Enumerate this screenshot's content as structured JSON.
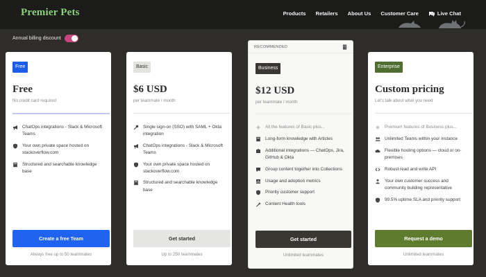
{
  "brand": {
    "name": "Premier Pets"
  },
  "nav": {
    "items": [
      "Products",
      "Retailers",
      "About Us",
      "Customer Care"
    ],
    "chat_label": "Live Chat"
  },
  "billing": {
    "label": "Annual billing discount",
    "enabled": true
  },
  "accent_colors": {
    "free": "#1d5ce8",
    "business": "#3a3733",
    "enterprise": "#4f6d31",
    "toggle": "#c8467e",
    "logo": "#8bd17c"
  },
  "plans": [
    {
      "badge": "Free",
      "price": "Free",
      "subtitle": "No credit card required",
      "features": [
        {
          "icon": "megaphone-icon",
          "text": "ChatOps integrations - Slack & Microsoft Teams"
        },
        {
          "icon": "shield-icon",
          "text": "Your own private space hosted on stackoverflow.com"
        },
        {
          "icon": "book-icon",
          "text": "Structured and searchable knowledge base"
        }
      ],
      "button": "Create a free Team",
      "footnote": "Always free up to 50 teammates"
    },
    {
      "badge": "Basic",
      "price": "$6 USD",
      "subtitle": "per teammate / month",
      "features": [
        {
          "icon": "key-icon",
          "text": "Single sign-on (SSO) with SAML + Okta integration"
        },
        {
          "icon": "megaphone-icon",
          "text": "ChatOps integrations - Slack & Microsoft Teams"
        },
        {
          "icon": "shield-icon",
          "text": "Your own private space hosted on stackoverflow.com"
        },
        {
          "icon": "book-icon",
          "text": "Structured and searchable knowledge base"
        }
      ],
      "button": "Get started",
      "footnote": "Up to 250 teammates"
    },
    {
      "recommended": "RECOMMENDED",
      "badge": "Business",
      "price": "$12 USD",
      "subtitle": "per teammate / month",
      "features": [
        {
          "icon": "plus-icon",
          "text": "All the features of Basic plus...",
          "muted": true
        },
        {
          "icon": "book-icon",
          "text": "Long-form knowledge with Articles"
        },
        {
          "icon": "puzzle-icon",
          "text": "Additional integrations — ChatOps, Jira, GitHub & Okta"
        },
        {
          "icon": "chat-icon",
          "text": "Group content together into Collections"
        },
        {
          "icon": "chart-icon",
          "text": "Usage and adoption metrics"
        },
        {
          "icon": "shield-icon",
          "text": "Priority customer support"
        },
        {
          "icon": "wrench-icon",
          "text": "Content Health tools"
        }
      ],
      "button": "Get started",
      "footnote": "Unlimited teammates"
    },
    {
      "badge": "Enterprise",
      "price": "Custom pricing",
      "subtitle": "Let’s talk about what you need",
      "features": [
        {
          "icon": "plus-icon",
          "text": "Premium features of Business plus...",
          "muted": true
        },
        {
          "icon": "users-icon",
          "text": "Unlimited Teams within your instance"
        },
        {
          "icon": "cloud-icon",
          "text": "Flexible hosting options — cloud or on-premises"
        },
        {
          "icon": "code-icon",
          "text": "Robust read and write API"
        },
        {
          "icon": "person-icon",
          "text": "Your own customer success and community building representative"
        },
        {
          "icon": "shield-icon",
          "text": "99.5% uptime SLA and priority support"
        }
      ],
      "button": "Request a demo",
      "footnote": "Unlimited teammates"
    }
  ]
}
